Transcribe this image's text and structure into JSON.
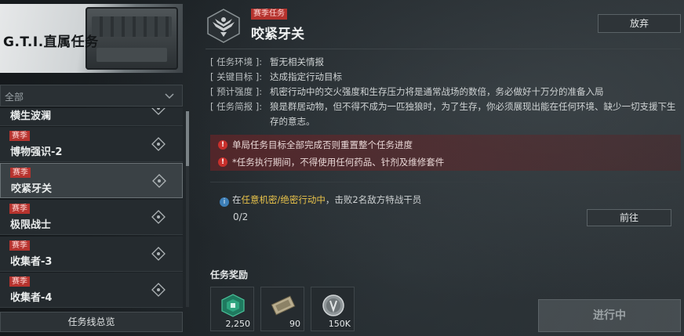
{
  "sidebar": {
    "banner_title": "G.T.I.直属任务",
    "filter_label": "全部",
    "items": [
      {
        "tag": "",
        "name": "横生波澜"
      },
      {
        "tag": "赛季",
        "name": "博物强识-2"
      },
      {
        "tag": "赛季",
        "name": "咬紧牙关"
      },
      {
        "tag": "赛季",
        "name": "极限战士"
      },
      {
        "tag": "赛季",
        "name": "收集者-3"
      },
      {
        "tag": "赛季",
        "name": "收集者-4"
      }
    ],
    "overview_label": "任务线总览"
  },
  "mission": {
    "season_tag": "赛季任务",
    "title": "咬紧牙关",
    "abandon_label": "放弃",
    "info": [
      {
        "key": "[ 任务环境 ]:",
        "value": "暂无相关情报"
      },
      {
        "key": "[ 关键目标 ]:",
        "value": "达成指定行动目标"
      },
      {
        "key": "[ 预计强度 ]:",
        "value": "机密行动中的交火强度和生存压力将是通常战场的数倍，务必做好十万分的准备入局"
      },
      {
        "key": "[ 任务简报 ]:",
        "value": "狼是群居动物，但不得不成为一匹独狼时，为了生存，你必须展现出能在任何环境、缺少一切支援下生存的意志。"
      }
    ],
    "warnings": [
      "单局任务目标全部完成否则重置整个任务进度",
      "*任务执行期间，不得使用任何药品、针剂及维修套件"
    ],
    "objective": {
      "prefix": "在",
      "highlight": "任意机密/绝密行动中",
      "suffix": "，击败2名敌方特战干员",
      "progress": "0/2",
      "goto_label": "前往"
    },
    "rewards_title": "任务奖励",
    "rewards": [
      {
        "icon": "token-icon",
        "amount": "2,250"
      },
      {
        "icon": "ticket-icon",
        "amount": "90"
      },
      {
        "icon": "coin-icon",
        "amount": "150K"
      }
    ],
    "status_button": "进行中"
  },
  "colors": {
    "season_red": "#b6332e",
    "highlight_yellow": "#e8c24a",
    "warning_bg": "#782326"
  }
}
